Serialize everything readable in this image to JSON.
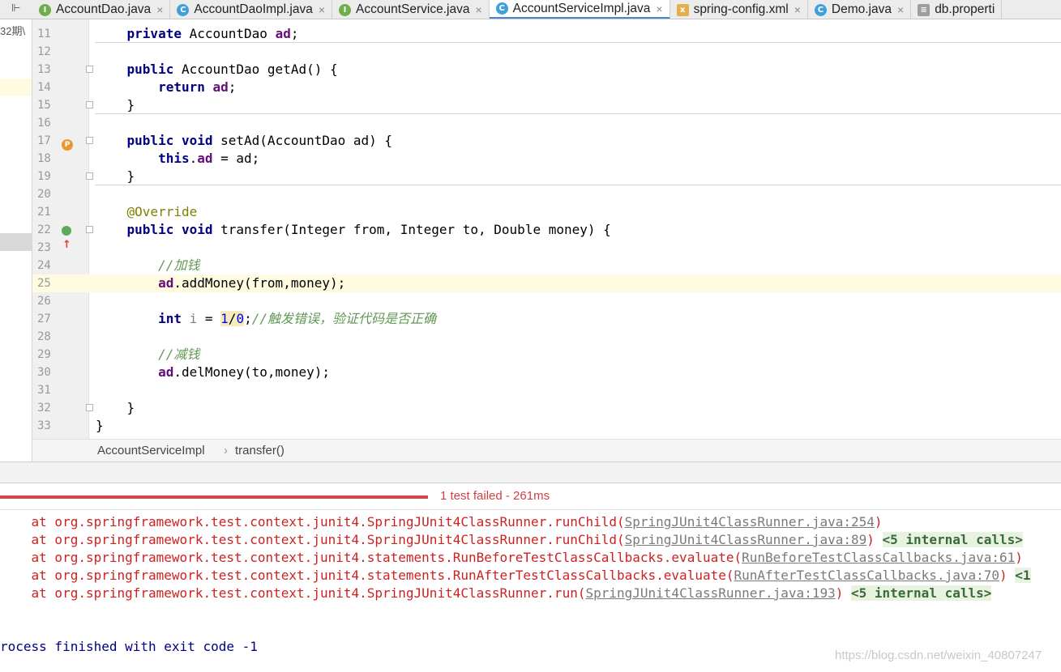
{
  "tool_window": {
    "icon": "structure-icon",
    "glyph": "⊩"
  },
  "tabs": [
    {
      "label": "AccountDao.java",
      "icon": "I",
      "type": "iface",
      "active": false,
      "close": "×"
    },
    {
      "label": "AccountDaoImpl.java",
      "icon": "C",
      "type": "cls",
      "active": false,
      "close": "×"
    },
    {
      "label": "AccountService.java",
      "icon": "I",
      "type": "iface",
      "active": false,
      "close": "×"
    },
    {
      "label": "AccountServiceImpl.java",
      "icon": "C",
      "type": "cls",
      "active": true,
      "close": "×"
    },
    {
      "label": "spring-config.xml",
      "icon": "x",
      "type": "xml",
      "active": false,
      "close": "×"
    },
    {
      "label": "Demo.java",
      "icon": "C",
      "type": "demo",
      "active": false,
      "close": "×"
    },
    {
      "label": "db.properti",
      "icon": "≡",
      "type": "prop",
      "active": false,
      "close": ""
    }
  ],
  "project_panel": {
    "label": "32期\\"
  },
  "editor": {
    "current_line": 25,
    "lines": [
      {
        "n": "11",
        "html": "    <span class=\"kw\">private</span> AccountDao <span class=\"fld\">ad</span>;",
        "sep": true
      },
      {
        "n": "12",
        "html": ""
      },
      {
        "n": "13",
        "html": "    <span class=\"kw\">public</span> AccountDao getAd() {",
        "fold": true
      },
      {
        "n": "14",
        "html": "        <span class=\"kw\">return</span> <span class=\"fld\">ad</span>;"
      },
      {
        "n": "15",
        "html": "    }",
        "fold": true,
        "sep": true
      },
      {
        "n": "16",
        "html": ""
      },
      {
        "n": "17",
        "html": "    <span class=\"kw\">public void</span> setAd(AccountDao ad) {",
        "fold": true,
        "mark": "p"
      },
      {
        "n": "18",
        "html": "        <span class=\"kw\">this</span>.<span class=\"fld\">ad</span> = ad;"
      },
      {
        "n": "19",
        "html": "    }",
        "fold": true,
        "sep": true
      },
      {
        "n": "20",
        "html": ""
      },
      {
        "n": "21",
        "html": "    <span class=\"ann\">@Override</span>"
      },
      {
        "n": "22",
        "html": "    <span class=\"kw\">public void</span> transfer(Integer from, Integer to, Double money) {",
        "fold": true,
        "mark": "o"
      },
      {
        "n": "23",
        "html": ""
      },
      {
        "n": "24",
        "html": "        <span class=\"cmt\">//加钱</span>"
      },
      {
        "n": "25",
        "html": "        <span class=\"fld\">ad</span>.addMoney(from,money);"
      },
      {
        "n": "26",
        "html": ""
      },
      {
        "n": "27",
        "html": "        <span class=\"kw\">int</span> <span class=\"var-unused\">i</span> = <span class=\"hl-warn\"><span class=\"num\">1</span>/<span class=\"num\">0</span></span>;<span class=\"cmt\">//触发错误，验证代码是否正确</span>"
      },
      {
        "n": "28",
        "html": ""
      },
      {
        "n": "29",
        "html": "        <span class=\"cmt\">//减钱</span>"
      },
      {
        "n": "30",
        "html": "        <span class=\"fld\">ad</span>.delMoney(to,money);"
      },
      {
        "n": "31",
        "html": ""
      },
      {
        "n": "32",
        "html": "    }",
        "fold": true
      },
      {
        "n": "33",
        "html": "}"
      }
    ]
  },
  "breadcrumb": {
    "class_name": "AccountServiceImpl",
    "separator": "›",
    "method_name": "transfer()"
  },
  "test_status": {
    "text": "1 test failed - 261ms",
    "progress_fraction": 0.403,
    "color": "#d2474a"
  },
  "console": {
    "lines": [
      {
        "html": "    at org.springframework.test.context.junit4.SpringJUnit4ClassRunner.runChild(<span class=\"lnk\">SpringJUnit4ClassRunner.java:254</span>)"
      },
      {
        "html": "    at org.springframework.test.context.junit4.SpringJUnit4ClassRunner.runChild(<span class=\"lnk\">SpringJUnit4ClassRunner.java:89</span>) <span class=\"internal\">&lt;5 internal calls&gt;</span>"
      },
      {
        "html": "    at org.springframework.test.context.junit4.statements.RunBeforeTestClassCallbacks.evaluate(<span class=\"lnk\">RunBeforeTestClassCallbacks.java:61</span>)"
      },
      {
        "html": "    at org.springframework.test.context.junit4.statements.RunAfterTestClassCallbacks.evaluate(<span class=\"lnk\">RunAfterTestClassCallbacks.java:70</span>) <span class=\"internal\">&lt;1</span>"
      },
      {
        "html": "    at org.springframework.test.context.junit4.SpringJUnit4ClassRunner.run(<span class=\"lnk\">SpringJUnit4ClassRunner.java:193</span>) <span class=\"internal\">&lt;5 internal calls&gt;</span>"
      }
    ],
    "exit_line": "rocess finished with exit code -1"
  },
  "watermark": "https://blog.csdn.net/weixin_40807247"
}
